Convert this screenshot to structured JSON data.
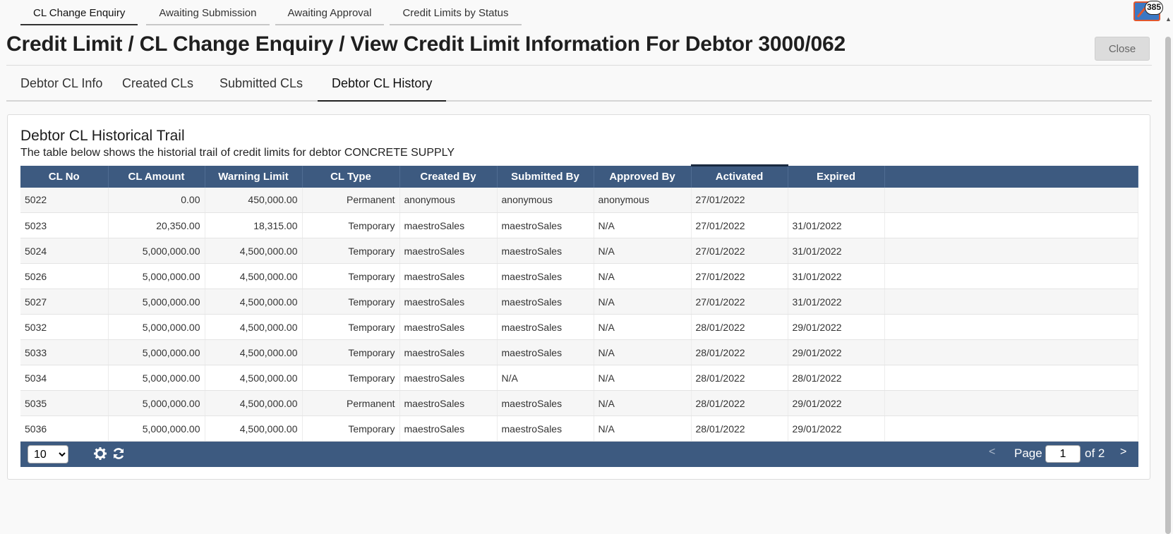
{
  "top_tabs": [
    "CL Change Enquiry",
    "Awaiting Submission",
    "Awaiting Approval",
    "Credit Limits by Status"
  ],
  "notification": {
    "count": "385"
  },
  "page": {
    "title": "Credit Limit / CL Change Enquiry / View Credit Limit Information For Debtor 3000/062",
    "close_label": "Close"
  },
  "sub_tabs": [
    "Debtor CL Info",
    "Created CLs",
    "Submitted CLs",
    "Debtor CL History"
  ],
  "card": {
    "title": "Debtor CL Historical Trail",
    "subtitle": "The table below shows the historial trail of credit limits for debtor CONCRETE SUPPLY"
  },
  "table": {
    "columns": [
      "CL No",
      "CL Amount",
      "Warning Limit",
      "CL Type",
      "Created By",
      "Submitted By",
      "Approved By",
      "Activated",
      "Expired"
    ],
    "rows": [
      [
        "5022",
        "0.00",
        "450,000.00",
        "Permanent",
        "anonymous",
        "anonymous",
        "anonymous",
        "27/01/2022",
        ""
      ],
      [
        "5023",
        "20,350.00",
        "18,315.00",
        "Temporary",
        "maestroSales",
        "maestroSales",
        "N/A",
        "27/01/2022",
        "31/01/2022"
      ],
      [
        "5024",
        "5,000,000.00",
        "4,500,000.00",
        "Temporary",
        "maestroSales",
        "maestroSales",
        "N/A",
        "27/01/2022",
        "31/01/2022"
      ],
      [
        "5026",
        "5,000,000.00",
        "4,500,000.00",
        "Temporary",
        "maestroSales",
        "maestroSales",
        "N/A",
        "27/01/2022",
        "31/01/2022"
      ],
      [
        "5027",
        "5,000,000.00",
        "4,500,000.00",
        "Temporary",
        "maestroSales",
        "maestroSales",
        "N/A",
        "27/01/2022",
        "31/01/2022"
      ],
      [
        "5032",
        "5,000,000.00",
        "4,500,000.00",
        "Temporary",
        "maestroSales",
        "maestroSales",
        "N/A",
        "28/01/2022",
        "29/01/2022"
      ],
      [
        "5033",
        "5,000,000.00",
        "4,500,000.00",
        "Temporary",
        "maestroSales",
        "maestroSales",
        "N/A",
        "28/01/2022",
        "29/01/2022"
      ],
      [
        "5034",
        "5,000,000.00",
        "4,500,000.00",
        "Temporary",
        "maestroSales",
        "N/A",
        "N/A",
        "28/01/2022",
        "28/01/2022"
      ],
      [
        "5035",
        "5,000,000.00",
        "4,500,000.00",
        "Permanent",
        "maestroSales",
        "maestroSales",
        "N/A",
        "28/01/2022",
        "29/01/2022"
      ],
      [
        "5036",
        "5,000,000.00",
        "4,500,000.00",
        "Temporary",
        "maestroSales",
        "maestroSales",
        "N/A",
        "28/01/2022",
        "29/01/2022"
      ]
    ]
  },
  "pager": {
    "page_size": "10",
    "page_size_options": [
      "10"
    ],
    "prev_label": "<",
    "page_label": "Page",
    "current_page": "1",
    "of_label": "of 2",
    "next_label": ">",
    "icons": [
      "gear-icon",
      "refresh-icon"
    ]
  }
}
